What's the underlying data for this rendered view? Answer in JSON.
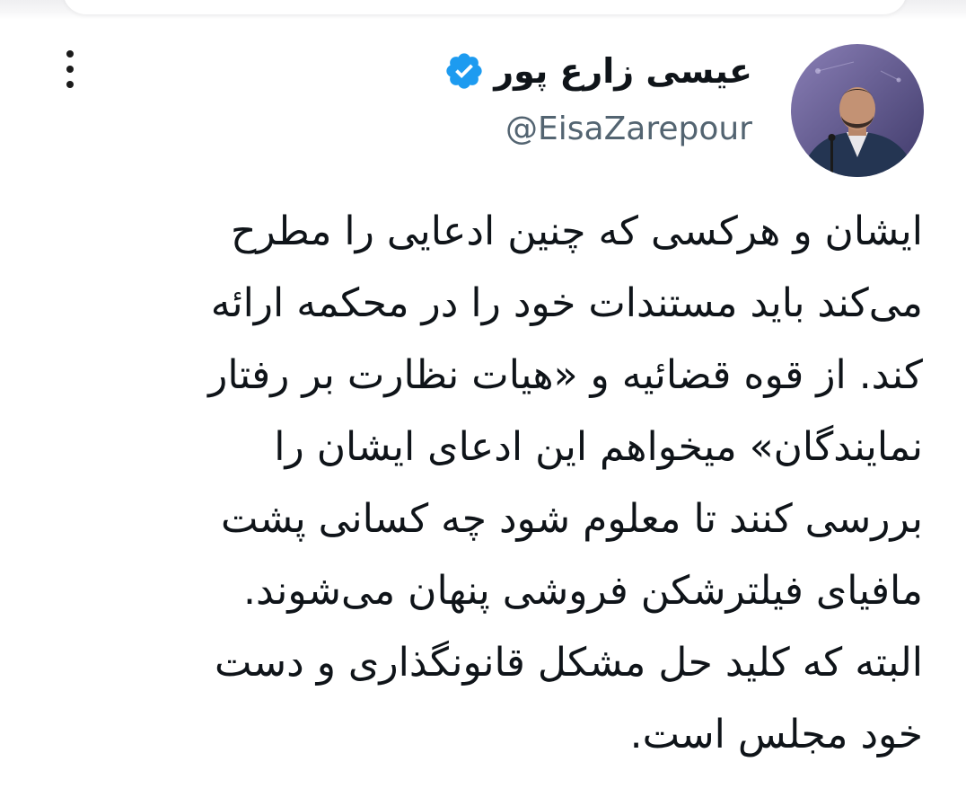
{
  "author": {
    "display_name": "عیسی زارع پور",
    "handle": "@EisaZarepour",
    "avatar_icon": "profile-photo",
    "verified_icon": "verified-badge-icon",
    "verified_color": "#1d9bf0"
  },
  "actions": {
    "more_icon": "more-options-icon"
  },
  "tweet": {
    "lines": [
      "ایشان و هرکسی که چنین ادعایی را مطرح",
      "می‌کند باید مستندات خود را در محکمه ارائه",
      "کند. از قوه قضائیه و «هیات نظارت بر رفتار",
      "نمایندگان» میخواهم این ادعای ایشان را",
      "بررسی کنند تا معلوم شود چه کسانی پشت",
      "مافیای فیلترشکن فروشی پنهان می‌شوند.",
      "البته که کلید حل مشکل قانونگذاری و دست",
      "خود مجلس است."
    ]
  }
}
